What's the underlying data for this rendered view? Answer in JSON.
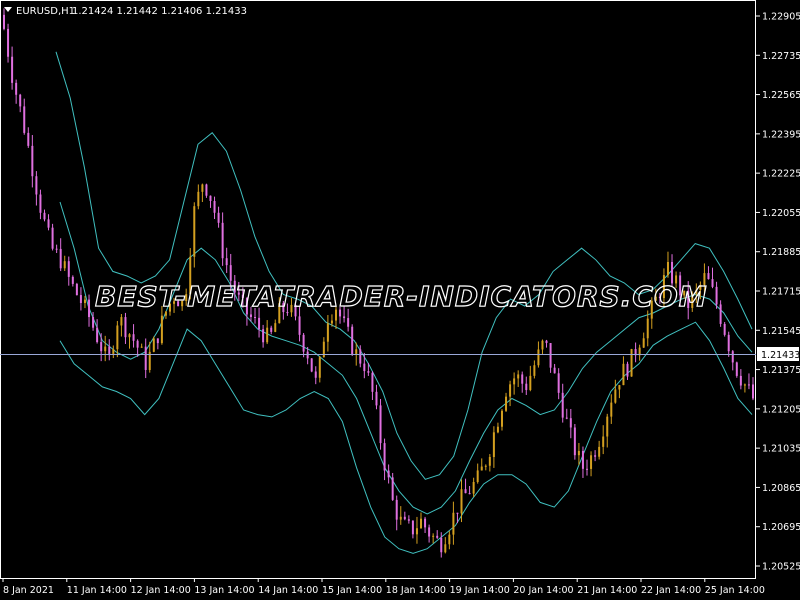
{
  "header": {
    "symbol": "EURUSD,H1",
    "ohlc": "1.21424 1.21442 1.21406 1.21433"
  },
  "watermark": "BEST-METATRADER-INDICATORS.COM",
  "current_price": "1.21433",
  "colors": {
    "background": "#000000",
    "bull_candle": "#d4a020",
    "bear_candle": "#e070e0",
    "bands": "#40c0c0",
    "grid": "#ffffff",
    "price_line": "#9aa8d8"
  },
  "chart_data": {
    "type": "candlestick",
    "y_ticks": [
      "1.22905",
      "1.22735",
      "1.22565",
      "1.22395",
      "1.22225",
      "1.22055",
      "1.21885",
      "1.21715",
      "1.21545",
      "1.21375",
      "1.21205",
      "1.21035",
      "1.20865",
      "1.20695",
      "1.20525"
    ],
    "ylim": [
      1.2048,
      1.2298
    ],
    "x_ticks": [
      "8 Jan 2021",
      "11 Jan 14:00",
      "12 Jan 14:00",
      "13 Jan 14:00",
      "14 Jan 14:00",
      "15 Jan 14:00",
      "18 Jan 14:00",
      "19 Jan 14:00",
      "20 Jan 14:00",
      "21 Jan 14:00",
      "22 Jan 14:00",
      "25 Jan 14:00"
    ],
    "close_series": [
      1.2285,
      1.2262,
      1.2245,
      1.2225,
      1.2205,
      1.219,
      1.2185,
      1.2175,
      1.2168,
      1.216,
      1.215,
      1.214,
      1.216,
      1.2155,
      1.2148,
      1.214,
      1.215,
      1.2162,
      1.217,
      1.2165,
      1.2205,
      1.222,
      1.221,
      1.219,
      1.2175,
      1.2165,
      1.216,
      1.2155,
      1.215,
      1.2162,
      1.2165,
      1.2155,
      1.2145,
      1.213,
      1.216,
      1.2165,
      1.2155,
      1.2145,
      1.214,
      1.2125,
      1.21,
      1.208,
      1.207,
      1.2068,
      1.2072,
      1.2066,
      1.2062,
      1.207,
      1.208,
      1.2085,
      1.209,
      1.21,
      1.2115,
      1.213,
      1.2135,
      1.213,
      1.214,
      1.215,
      1.2135,
      1.212,
      1.2105,
      1.2095,
      1.21,
      1.211,
      1.2125,
      1.2135,
      1.214,
      1.215,
      1.216,
      1.217,
      1.218,
      1.2175,
      1.2165,
      1.217,
      1.2178,
      1.2168,
      1.2155,
      1.214,
      1.2132,
      1.2125
    ],
    "upper_band": [
      1.2275,
      1.2255,
      1.2225,
      1.219,
      1.218,
      1.2178,
      1.2175,
      1.2178,
      1.2185,
      1.221,
      1.2235,
      1.224,
      1.2232,
      1.2215,
      1.2195,
      1.218,
      1.217,
      1.2168,
      1.2165,
      1.2158,
      1.2155,
      1.215,
      1.214,
      1.2128,
      1.211,
      1.2098,
      1.209,
      1.2092,
      1.21,
      1.212,
      1.2145,
      1.216,
      1.2168,
      1.2165,
      1.217,
      1.218,
      1.2185,
      1.219,
      1.2185,
      1.2178,
      1.2175,
      1.217,
      1.2172,
      1.2178,
      1.2185,
      1.2192,
      1.219,
      1.218,
      1.2168,
      1.2155
    ],
    "middle_band": [
      1.221,
      1.219,
      1.2165,
      1.215,
      1.2145,
      1.2142,
      1.2145,
      1.2155,
      1.217,
      1.2185,
      1.219,
      1.2185,
      1.2175,
      1.2162,
      1.2155,
      1.2152,
      1.215,
      1.2148,
      1.2145,
      1.214,
      1.2135,
      1.2125,
      1.211,
      1.2095,
      1.2085,
      1.2078,
      1.2075,
      1.2078,
      1.2085,
      1.2098,
      1.211,
      1.212,
      1.2125,
      1.2122,
      1.2118,
      1.212,
      1.2128,
      1.2138,
      1.2145,
      1.215,
      1.2155,
      1.216,
      1.2162,
      1.2165,
      1.2168,
      1.217,
      1.2168,
      1.2162,
      1.2152,
      1.2145
    ],
    "lower_band": [
      1.215,
      1.214,
      1.2135,
      1.213,
      1.2128,
      1.2125,
      1.2118,
      1.2125,
      1.214,
      1.2155,
      1.215,
      1.214,
      1.213,
      1.212,
      1.2118,
      1.2117,
      1.212,
      1.2125,
      1.2128,
      1.2125,
      1.2115,
      1.2095,
      1.2078,
      1.2065,
      1.206,
      1.2058,
      1.206,
      1.2065,
      1.207,
      1.208,
      1.2088,
      1.2092,
      1.2092,
      1.2088,
      1.208,
      1.2078,
      1.2085,
      1.21,
      1.2115,
      1.2128,
      1.2135,
      1.214,
      1.2148,
      1.2152,
      1.2155,
      1.2158,
      1.215,
      1.2138,
      1.2125,
      1.2118
    ]
  }
}
